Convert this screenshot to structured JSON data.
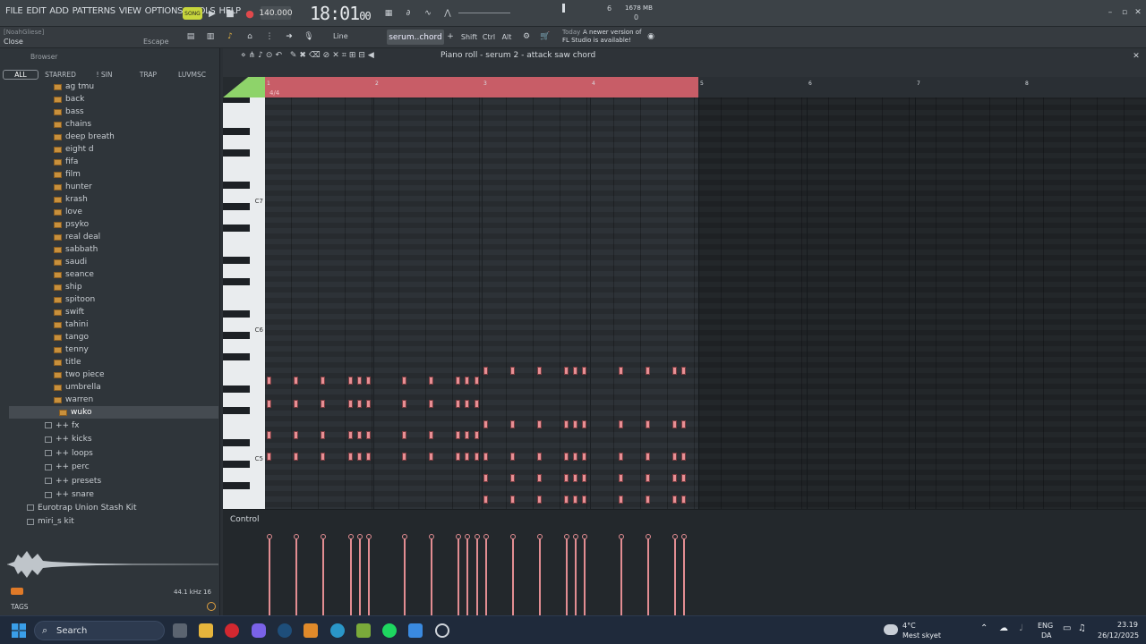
{
  "menus": [
    "FILE",
    "EDIT",
    "ADD",
    "PATTERNS",
    "VIEW",
    "OPTIONS",
    "TOOLS",
    "HELP"
  ],
  "transport": {
    "mode_label": "SONG",
    "tempo": "140.000",
    "time": "18:01",
    "time_sub": "00",
    "cpu_mb": "1678 MB",
    "poly": "6",
    "cpu_zero": "0"
  },
  "hint": {
    "user": "[NoahGliese]",
    "action": "Close",
    "shortcut": "Escape"
  },
  "toolbar2": {
    "snap_label": "Line",
    "pattern": "serum..chord",
    "shift": "Shift",
    "ctrl": "Ctrl",
    "alt": "Alt",
    "news_date": "Today",
    "news_line1": "A newer version of",
    "news_line2": "FL Studio is available!"
  },
  "browser": {
    "title": "Browser",
    "tabs": [
      "ALL",
      "STARRED",
      "! SIN",
      "TRAP",
      "LUVMSC"
    ],
    "folders": [
      "ag tmu",
      "back",
      "bass",
      "chains",
      "deep breath",
      "eight d",
      "fifa",
      "film",
      "hunter",
      "krash",
      "love",
      "psyko",
      "real deal",
      "sabbath",
      "saudi",
      "seance",
      "ship",
      "spitoon",
      "swift",
      "tahini",
      "tango",
      "tenny",
      "title",
      "two piece",
      "umbrella",
      "warren"
    ],
    "selected_folder": "wuko",
    "subfolders": [
      "++ fx",
      "++ kicks",
      "++ loops",
      "++ perc",
      "++ presets",
      "++ snare"
    ],
    "packs": [
      "Eurotrap Union Stash Kit",
      "miri_s kit"
    ],
    "sample_info": "44.1 kHz 16",
    "tags_label": "TAGS"
  },
  "piano_roll": {
    "title": "Piano roll - serum 2 - attack saw chord",
    "time_sig": "4/4",
    "bars": [
      "1",
      "2",
      "3",
      "4",
      "5",
      "6",
      "7",
      "8"
    ],
    "octave_labels": [
      "C7",
      "C6",
      "C5"
    ],
    "control_label": "Control",
    "accent": "#e88f94"
  },
  "chart_data": {
    "type": "scatter",
    "note_times_first_half": [
      0,
      1,
      2,
      3,
      3.33,
      3.67,
      5,
      6,
      7,
      7.33,
      7.67
    ],
    "note_times_second_half": [
      8,
      9,
      10,
      11,
      11.33,
      11.67,
      13,
      14,
      15,
      15.33
    ],
    "rows_first_half": [
      0,
      1,
      2,
      3
    ],
    "rows_second_half": [
      4,
      5,
      6,
      7
    ]
  },
  "taskbar": {
    "search": "Search",
    "weather_temp": "4°C",
    "weather_desc": "Mest skyet",
    "lang1": "ENG",
    "lang2": "DA",
    "clock": "23.19",
    "date": "26/12/2025"
  }
}
